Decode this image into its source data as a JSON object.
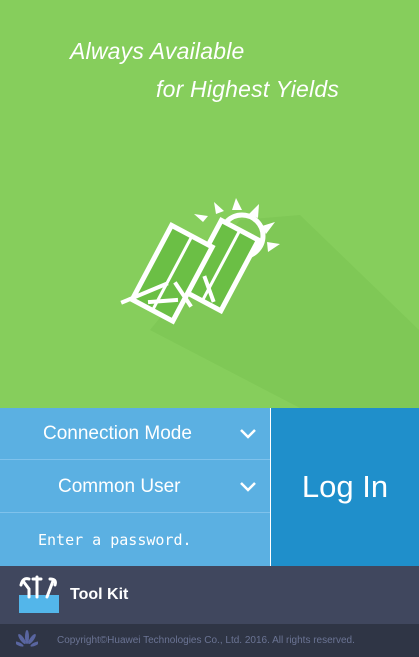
{
  "colors": {
    "hero_bg": "#86ce5c",
    "control_bg": "#5bb0e2",
    "login_bg": "#1f8fcb",
    "toolkit_bg": "#40475e",
    "footer_bg": "#2f3545",
    "copyright_text": "#6b7494"
  },
  "hero": {
    "tagline_line1": "Always Available",
    "tagline_line2": "for Highest Yields",
    "illustration_icon": "solar-panel-sun-icon"
  },
  "login_form": {
    "connection_mode": {
      "selected": "Connection Mode",
      "icon": "chevron-down-icon"
    },
    "user_type": {
      "selected": "Common User",
      "icon": "chevron-down-icon"
    },
    "password": {
      "value": "",
      "placeholder": "Enter a password."
    },
    "login_label": "Log In"
  },
  "toolkit": {
    "label": "Tool Kit",
    "icon": "toolbox-icon"
  },
  "footer": {
    "logo_icon": "huawei-logo-icon",
    "copyright": "Copyright©Huawei Technologies Co., Ltd. 2016. All rights reserved."
  }
}
